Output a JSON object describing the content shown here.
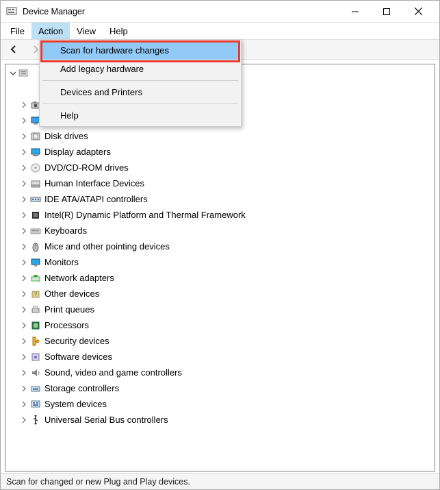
{
  "window": {
    "title": "Device Manager"
  },
  "menubar": {
    "items": [
      "File",
      "Action",
      "View",
      "Help"
    ],
    "active_index": 1
  },
  "action_menu": {
    "items": [
      {
        "label": "Scan for hardware changes",
        "highlighted": true
      },
      {
        "label": "Add legacy hardware"
      },
      {
        "label": "Devices and Printers"
      },
      {
        "label": "Help"
      }
    ],
    "separators_after": [
      1,
      2
    ]
  },
  "tree": {
    "root": {
      "label": "",
      "expanded": true
    },
    "nodes": [
      {
        "label": "",
        "icon": "audio-chip-icon",
        "expanded": true,
        "child": true
      },
      {
        "label": "Cameras",
        "icon": "camera-icon"
      },
      {
        "label": "Computer",
        "icon": "computer-icon"
      },
      {
        "label": "Disk drives",
        "icon": "disk-icon"
      },
      {
        "label": "Display adapters",
        "icon": "display-adapter-icon"
      },
      {
        "label": "DVD/CD-ROM drives",
        "icon": "optical-disc-icon"
      },
      {
        "label": "Human Interface Devices",
        "icon": "hid-icon"
      },
      {
        "label": "IDE ATA/ATAPI controllers",
        "icon": "ide-icon"
      },
      {
        "label": "Intel(R) Dynamic Platform and Thermal Framework",
        "icon": "chip-icon"
      },
      {
        "label": "Keyboards",
        "icon": "keyboard-icon"
      },
      {
        "label": "Mice and other pointing devices",
        "icon": "mouse-icon"
      },
      {
        "label": "Monitors",
        "icon": "monitor-icon"
      },
      {
        "label": "Network adapters",
        "icon": "network-icon"
      },
      {
        "label": "Other devices",
        "icon": "other-device-icon"
      },
      {
        "label": "Print queues",
        "icon": "printer-icon"
      },
      {
        "label": "Processors",
        "icon": "cpu-icon"
      },
      {
        "label": "Security devices",
        "icon": "security-icon"
      },
      {
        "label": "Software devices",
        "icon": "software-device-icon"
      },
      {
        "label": "Sound, video and game controllers",
        "icon": "sound-icon"
      },
      {
        "label": "Storage controllers",
        "icon": "storage-icon"
      },
      {
        "label": "System devices",
        "icon": "system-icon"
      },
      {
        "label": "Universal Serial Bus controllers",
        "icon": "usb-icon"
      }
    ]
  },
  "statusbar": {
    "text": "Scan for changed or new Plug and Play devices."
  }
}
